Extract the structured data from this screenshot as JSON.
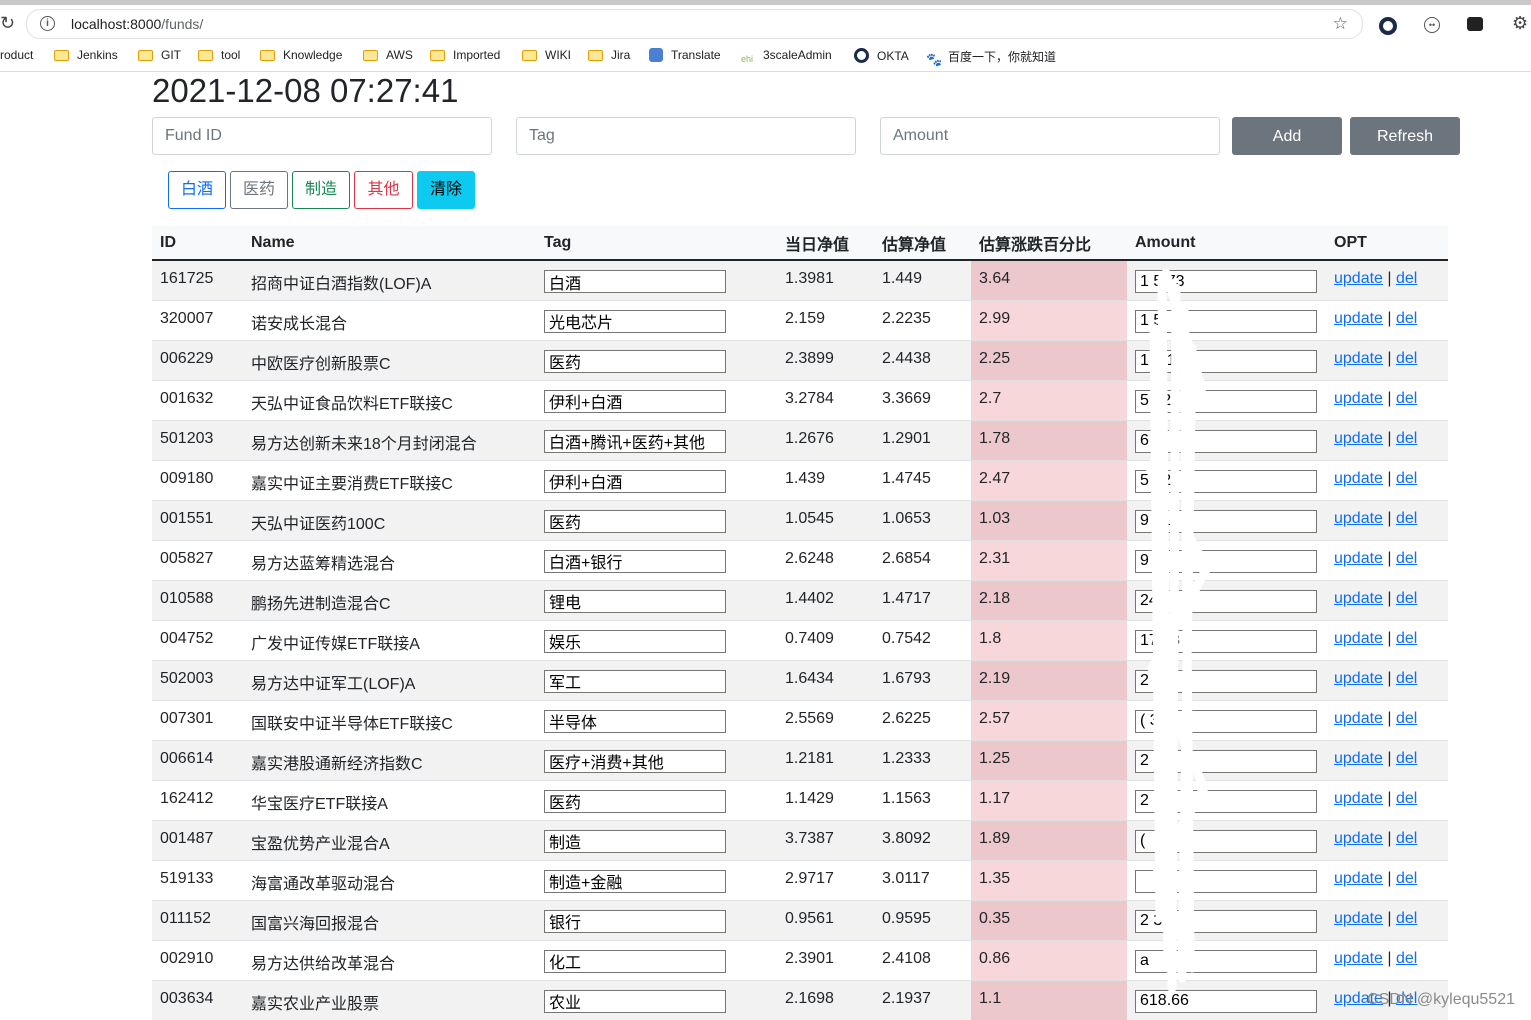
{
  "browser": {
    "url_host": "localhost:8000",
    "url_path": "/funds/",
    "bookmarks": [
      {
        "label": "roduct",
        "icon": "none"
      },
      {
        "label": "Jenkins",
        "icon": "folder-icon"
      },
      {
        "label": "GIT",
        "icon": "folder-icon"
      },
      {
        "label": "tool",
        "icon": "folder-icon"
      },
      {
        "label": "Knowledge",
        "icon": "folder-icon"
      },
      {
        "label": "AWS",
        "icon": "folder-icon"
      },
      {
        "label": "Imported",
        "icon": "folder-icon"
      },
      {
        "label": "WIKI",
        "icon": "folder-icon"
      },
      {
        "label": "Jira",
        "icon": "folder-icon"
      },
      {
        "label": "Translate",
        "icon": "translate-icon"
      },
      {
        "label": "3scaleAdmin",
        "icon": "3scale-icon"
      },
      {
        "label": "OKTA",
        "icon": "okta-icon"
      },
      {
        "label": "百度一下，你就知道",
        "icon": "baidu-icon"
      }
    ]
  },
  "page": {
    "title": "2021-12-08 07:27:41",
    "form": {
      "fund_id_placeholder": "Fund ID",
      "tag_placeholder": "Tag",
      "amount_placeholder": "Amount",
      "add_label": "Add",
      "refresh_label": "Refresh"
    },
    "filters": [
      {
        "label": "白酒",
        "color": "#0d6efd"
      },
      {
        "label": "医药",
        "color": "#6c757d"
      },
      {
        "label": "制造",
        "color": "#198754"
      },
      {
        "label": "其他",
        "color": "#dc3545"
      },
      {
        "label": "清除",
        "color": "#0dcaf0"
      }
    ],
    "table": {
      "headers": [
        "ID",
        "Name",
        "Tag",
        "当日净值",
        "估算净值",
        "估算涨跌百分比",
        "Amount",
        "OPT"
      ],
      "update_label": "update",
      "del_label": "del",
      "separator": "|",
      "rows": [
        {
          "id": "161725",
          "name": "招商中证白酒指数(LOF)A",
          "tag": "白酒",
          "nav": "1.3981",
          "est": "1.449",
          "pct": "3.64",
          "amount": "1 5 73"
        },
        {
          "id": "320007",
          "name": "诺安成长混合",
          "tag": "光电芯片",
          "nav": "2.159",
          "est": "2.2235",
          "pct": "2.99",
          "amount": "1 5"
        },
        {
          "id": "006229",
          "name": "中欧医疗创新股票C",
          "tag": "医药",
          "nav": "2.3899",
          "est": "2.4438",
          "pct": "2.25",
          "amount": "1 2 1"
        },
        {
          "id": "001632",
          "name": "天弘中证食品饮料ETF联接C",
          "tag": "伊利+白酒",
          "nav": "3.2784",
          "est": "3.3669",
          "pct": "2.7",
          "amount": "5 32"
        },
        {
          "id": "501203",
          "name": "易方达创新未来18个月封闭混合",
          "tag": "白酒+腾讯+医药+其他",
          "nav": "1.2676",
          "est": "1.2901",
          "pct": "1.78",
          "amount": "6 46"
        },
        {
          "id": "009180",
          "name": "嘉实中证主要消费ETF联接C",
          "tag": "伊利+白酒",
          "nav": "1.439",
          "est": "1.4745",
          "pct": "2.47",
          "amount": "5 22"
        },
        {
          "id": "001551",
          "name": "天弘中证医药100C",
          "tag": "医药",
          "nav": "1.0545",
          "est": "1.0653",
          "pct": "1.03",
          "amount": "9 51"
        },
        {
          "id": "005827",
          "name": "易方达蓝筹精选混合",
          "tag": "白酒+银行",
          "nav": "2.6248",
          "est": "2.6854",
          "pct": "2.31",
          "amount": "9"
        },
        {
          "id": "010588",
          "name": "鹏扬先进制造混合C",
          "tag": "锂电",
          "nav": "1.4402",
          "est": "1.4717",
          "pct": "2.18",
          "amount": "24"
        },
        {
          "id": "004752",
          "name": "广发中证传媒ETF联接A",
          "tag": "娱乐",
          "nav": "0.7409",
          "est": "0.7542",
          "pct": "1.8",
          "amount": "17 48"
        },
        {
          "id": "502003",
          "name": "易方达中证军工(LOF)A",
          "tag": "军工",
          "nav": "1.6434",
          "est": "1.6793",
          "pct": "2.19",
          "amount": "2 4"
        },
        {
          "id": "007301",
          "name": "国联安中证半导体ETF联接C",
          "tag": "半导体",
          "nav": "2.5569",
          "est": "2.6225",
          "pct": "2.57",
          "amount": "( 3"
        },
        {
          "id": "006614",
          "name": "嘉实港股通新经济指数C",
          "tag": "医疗+消费+其他",
          "nav": "1.2181",
          "est": "1.2333",
          "pct": "1.25",
          "amount": "2 7"
        },
        {
          "id": "162412",
          "name": "华宝医疗ETF联接A",
          "tag": "医药",
          "nav": "1.1429",
          "est": "1.1563",
          "pct": "1.17",
          "amount": "2"
        },
        {
          "id": "001487",
          "name": "宝盈优势产业混合A",
          "tag": "制造",
          "nav": "3.7387",
          "est": "3.8092",
          "pct": "1.89",
          "amount": "("
        },
        {
          "id": "519133",
          "name": "海富通改革驱动混合",
          "tag": "制造+金融",
          "nav": "2.9717",
          "est": "3.0117",
          "pct": "1.35",
          "amount": ""
        },
        {
          "id": "011152",
          "name": "国富兴海回报混合",
          "tag": "银行",
          "nav": "0.9561",
          "est": "0.9595",
          "pct": "0.35",
          "amount": "2 3"
        },
        {
          "id": "002910",
          "name": "易方达供给改革混合",
          "tag": "化工",
          "nav": "2.3901",
          "est": "2.4108",
          "pct": "0.86",
          "amount": "a"
        },
        {
          "id": "003634",
          "name": "嘉实农业产业股票",
          "tag": "农业",
          "nav": "2.1698",
          "est": "2.1937",
          "pct": "1.1",
          "amount": "618.66"
        }
      ]
    }
  },
  "watermark": "CSDN @kylequ5521"
}
